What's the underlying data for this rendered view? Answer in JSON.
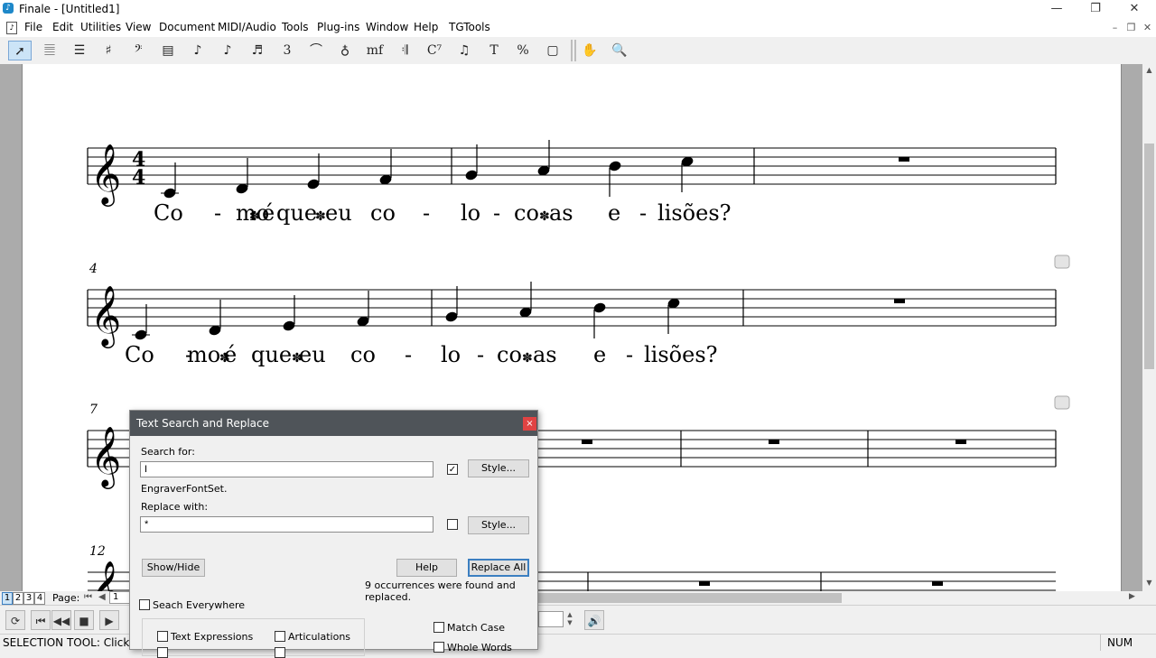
{
  "window": {
    "title": "Finale - [Untitled1]",
    "app_icon": "finale-logo-icon",
    "controls": [
      "minimize-icon",
      "restore-icon",
      "close-icon"
    ]
  },
  "menu": {
    "items": [
      "File",
      "Edit",
      "Utilities",
      "View",
      "Document",
      "MIDI/Audio",
      "Tools",
      "Plug-ins",
      "Window",
      "Help",
      "TGTools"
    ]
  },
  "toolbar": {
    "tools": [
      {
        "name": "selection-tool-icon",
        "glyph": "➚"
      },
      {
        "name": "staff-tool-icon",
        "glyph": "𝄚"
      },
      {
        "name": "measure-tool-icon",
        "glyph": "☰"
      },
      {
        "name": "key-signature-tool-icon",
        "glyph": "♯"
      },
      {
        "name": "clef-tool-icon",
        "glyph": "𝄢"
      },
      {
        "name": "time-signature-tool-icon",
        "glyph": "▤"
      },
      {
        "name": "simple-entry-tool-icon",
        "glyph": "♪"
      },
      {
        "name": "speedy-entry-tool-icon",
        "glyph": "♪"
      },
      {
        "name": "hyperscribe-tool-icon",
        "glyph": "♬"
      },
      {
        "name": "tuplet-tool-icon",
        "glyph": "3"
      },
      {
        "name": "smart-shape-tool-icon",
        "glyph": "⌒"
      },
      {
        "name": "articulation-tool-icon",
        "glyph": "♁"
      },
      {
        "name": "expression-tool-icon",
        "glyph": "mf"
      },
      {
        "name": "repeat-tool-icon",
        "glyph": "𝄇"
      },
      {
        "name": "chord-tool-icon",
        "glyph": "C⁷"
      },
      {
        "name": "lyrics-tool-icon",
        "glyph": "♫"
      },
      {
        "name": "text-tool-icon",
        "glyph": "T"
      },
      {
        "name": "resize-tool-icon",
        "glyph": "%"
      },
      {
        "name": "page-layout-tool-icon",
        "glyph": "▢"
      },
      {
        "name": "hand-grabber-tool-icon",
        "glyph": "✋"
      },
      {
        "name": "zoom-tool-icon",
        "glyph": "🔍"
      }
    ]
  },
  "score": {
    "time_signature": "4/4",
    "lyrics": [
      "Co",
      "-",
      "mo",
      "é",
      "que",
      "eu",
      "co",
      "-",
      "lo",
      "-",
      "co",
      "as",
      "e",
      "-",
      "lisões?"
    ],
    "system_numbers": [
      "4",
      "7",
      "12"
    ]
  },
  "dialog": {
    "title": "Text Search and Replace",
    "search_label": "Search for:",
    "search_value": "I",
    "font_hint": "EngraverFontSet.",
    "replace_label": "Replace with:",
    "replace_value": "*",
    "style_label": "Style...",
    "show_hide_label": "Show/Hide",
    "help_label": "Help",
    "replace_all_label": "Replace All",
    "result_text": "9 occurrences were found and replaced.",
    "search_everywhere_label": "Seach Everywhere",
    "text_expressions_label": "Text Expressions",
    "articulations_label": "Articulations",
    "match_case_label": "Match Case",
    "whole_words_label": "Whole Words"
  },
  "pagebar": {
    "page_buttons": [
      "1",
      "2",
      "3",
      "4"
    ],
    "page_label": "Page:",
    "page_value": "1"
  },
  "status": {
    "left": "SELECTION TOOL: Click an ol",
    "right": "NUM"
  }
}
